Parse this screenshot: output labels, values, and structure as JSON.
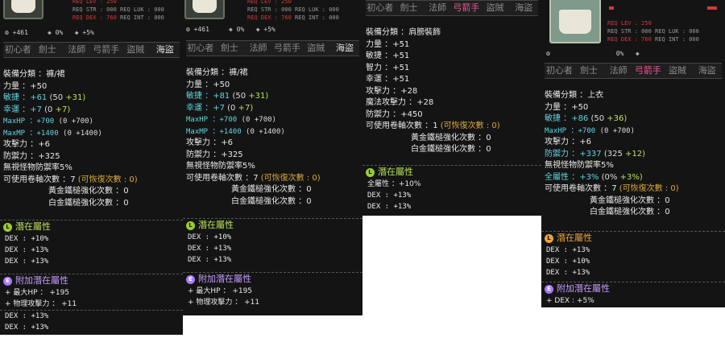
{
  "tabs": [
    "初心者",
    "劍士",
    "法師",
    "弓箭手",
    "盜賊",
    "海盜"
  ],
  "req": {
    "lev_label": "REQ LEV :",
    "lev_value": "250",
    "str_label": "REQ STR :",
    "str_value": "000",
    "luk_label": "REQ LUK :",
    "luk_value": "000",
    "dex_label": "REQ DEX :",
    "dex_value": "760",
    "int_label": "REQ INT :",
    "int_value": "000"
  },
  "topstats": {
    "v1": "+461",
    "v2": "0%",
    "v3": "+5%",
    "v4": "0%"
  },
  "labels": {
    "category": "裝備分類 ：",
    "str": "力量 ：",
    "dex": "敏捷 ：",
    "int": "智力 ：",
    "luk": "幸運 ：",
    "maxhp": "MaxHP ：",
    "maxmp": "MaxMP ：",
    "atk": "攻擊力 ：",
    "matk": "魔法攻擊力 ：",
    "def": "防禦力 ：",
    "ignore": "無視怪物防禦率5%",
    "scroll": "可使用卷軸次數 ：",
    "gold": "黃金鐵槌強化次數 ：",
    "white": "白金鐵槌強化次數 ：",
    "potential": "潛在屬性",
    "bonus": "附加潛在屬性",
    "all_stat": "全屬性 ："
  },
  "card1": {
    "category": "褲/裙",
    "str": "+50",
    "dex": "+61",
    "dex_detail": "(50 ",
    "dex_bonus": "+31)",
    "luk": "+7",
    "luk_detail": "(0 ",
    "luk_bonus": "+7)",
    "maxhp": "+700",
    "maxhp_detail": "(0 +700)",
    "maxmp": "+1400",
    "maxmp_detail": "(0 +1400)",
    "atk": "+6",
    "def": "+325",
    "scroll": "7",
    "scroll_note": "(可恢復次數 : 0)",
    "gold": "0",
    "white": "0",
    "pot": [
      "DEX : +10%",
      "DEX : +13%",
      "DEX : +13%"
    ],
    "bonus": [
      "+ 最大HP ： +195",
      "+ 物理攻擊力 ： +11"
    ],
    "extra": [
      "DEX : +13%",
      "DEX : +13%"
    ]
  },
  "card2": {
    "category": "褲/裙",
    "str": "+50",
    "dex": "+81",
    "dex_detail": "(50 ",
    "dex_bonus": "+31)",
    "luk": "+7",
    "luk_detail": "(0 ",
    "luk_bonus": "+7)",
    "maxhp": "+700",
    "maxhp_detail": "(0 +700)",
    "maxmp": "+1400",
    "maxmp_detail": "(0 +1400)",
    "atk": "+6",
    "def": "+325",
    "scroll": "7",
    "scroll_note": "(可恢復次數 : 0)",
    "gold": "0",
    "white": "0",
    "pot": [
      "DEX : +10%",
      "DEX : +13%",
      "DEX : +13%"
    ],
    "bonus": [
      "+ 最大HP ： +195",
      "+ 物理攻擊力 ： +11"
    ]
  },
  "card3": {
    "category": "肩膀裝飾",
    "str": "+51",
    "dex": "+51",
    "int": "+51",
    "luk": "+51",
    "atk": "+28",
    "matk": "+28",
    "def": "+450",
    "scroll": "1",
    "scroll_note": "(可恢復次數 : 0)",
    "gold": "0",
    "white": "0",
    "all_stat": "+10%",
    "pot": [
      "DEX : +13%",
      "DEX : +13%"
    ]
  },
  "card4": {
    "category": "上衣",
    "str": "+50",
    "dex": "+86",
    "dex_detail": "(50 ",
    "dex_bonus": "+36)",
    "maxhp": "+700",
    "maxhp_detail": "(0 +700)",
    "atk": "+6",
    "def": "+337",
    "def_detail": "(325 ",
    "def_bonus": "+12)",
    "all_stat": "+3%",
    "all_detail": "(0% ",
    "all_bonus": "+3%)",
    "scroll": "7",
    "scroll_note": "(可恢復次數 : 0)",
    "gold": "0",
    "white": "0",
    "pot": [
      "DEX : +13%",
      "DEX : +10%",
      "DEX : +13%"
    ],
    "bonus": [
      "+ DEX : +5%"
    ]
  }
}
